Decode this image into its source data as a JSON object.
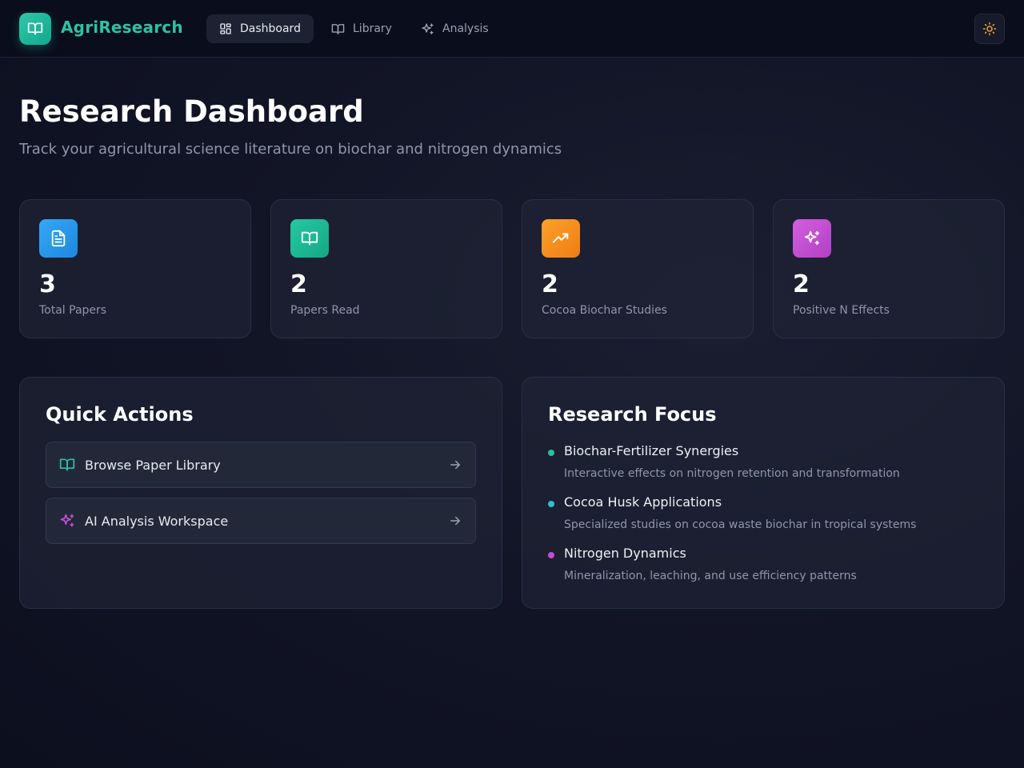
{
  "app": {
    "brand": "AgriResearch",
    "accent": "#2cc2a6"
  },
  "nav": {
    "items": [
      {
        "label": "Dashboard",
        "icon": "grid-icon",
        "active": true
      },
      {
        "label": "Library",
        "icon": "book-icon",
        "active": false
      },
      {
        "label": "Analysis",
        "icon": "sparkles-icon",
        "active": false
      }
    ],
    "theme_toggle_icon": "sun-icon"
  },
  "header": {
    "title": "Research Dashboard",
    "subtitle": "Track your agricultural science literature on biochar and nitrogen dynamics"
  },
  "stats": [
    {
      "value": "3",
      "label": "Total Papers",
      "icon": "document-icon",
      "color": "#2f9cf0"
    },
    {
      "value": "2",
      "label": "Papers Read",
      "icon": "book-icon",
      "color": "#1fbd97"
    },
    {
      "value": "2",
      "label": "Cocoa Biochar Studies",
      "icon": "trending-up-icon",
      "color": "#f7941e"
    },
    {
      "value": "2",
      "label": "Positive N Effects",
      "icon": "sparkles-icon",
      "color": "#c24fd0"
    }
  ],
  "quick_actions": {
    "title": "Quick Actions",
    "items": [
      {
        "label": "Browse Paper Library",
        "icon": "book-icon"
      },
      {
        "label": "AI Analysis Workspace",
        "icon": "sparkles-icon"
      }
    ]
  },
  "research_focus": {
    "title": "Research Focus",
    "items": [
      {
        "title": "Biochar-Fertilizer Synergies",
        "desc": "Interactive effects on nitrogen retention and transformation",
        "color": "#22c39a"
      },
      {
        "title": "Cocoa Husk Applications",
        "desc": "Specialized studies on cocoa waste biochar in tropical systems",
        "color": "#2bc3c9"
      },
      {
        "title": "Nitrogen Dynamics",
        "desc": "Mineralization, leaching, and use efficiency patterns",
        "color": "#c24fd0"
      }
    ]
  }
}
